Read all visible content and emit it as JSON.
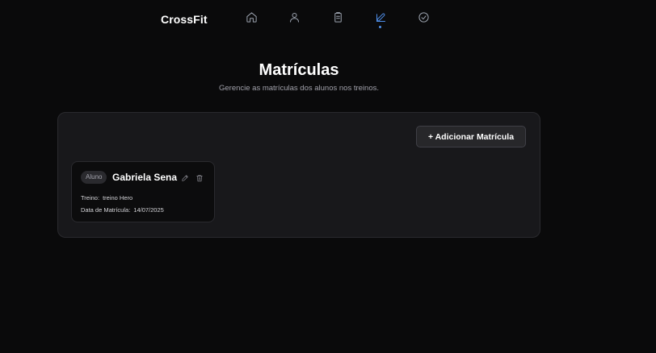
{
  "header": {
    "brand": "CrossFit",
    "nav": [
      {
        "name": "home-icon",
        "active": false
      },
      {
        "name": "user-icon",
        "active": false
      },
      {
        "name": "clipboard-icon",
        "active": false
      },
      {
        "name": "edit-icon",
        "active": true
      },
      {
        "name": "check-circle-icon",
        "active": false
      }
    ]
  },
  "page": {
    "title": "Matrículas",
    "subtitle": "Gerencie as matrículas dos alunos nos treinos."
  },
  "toolbar": {
    "add_label": "+ Adicionar Matrícula"
  },
  "enrollments": [
    {
      "badge": "Aluno",
      "name": "Gabriela Sena",
      "treino_label": "Treino:",
      "treino": "treino Hero",
      "data_label": "Data de Matrícula:",
      "data": "14/07/2025"
    }
  ],
  "colors": {
    "background": "#0a0a0b",
    "panel": "#18181b",
    "accent": "#4f8ee8",
    "muted": "#a1a1aa"
  }
}
